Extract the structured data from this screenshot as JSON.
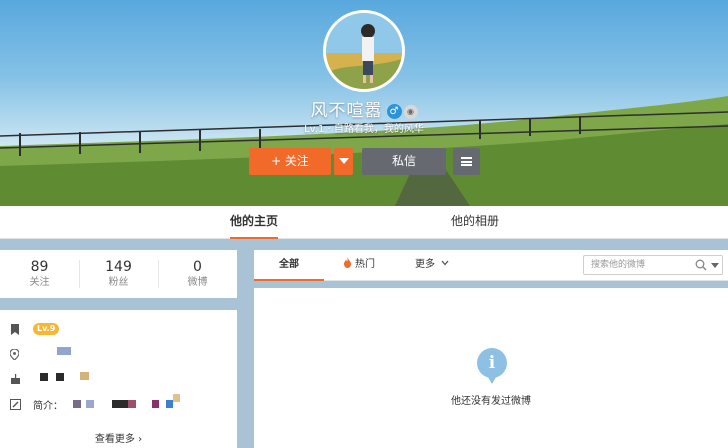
{
  "profile": {
    "name": "风不喧嚣",
    "bio": "Lv.1 · 自路看我，我的风华",
    "gender_icon": "male-icon",
    "badge_icon": "member-badge-icon"
  },
  "actions": {
    "follow_label": "+ 关注",
    "message_label": "私信"
  },
  "tabs": {
    "home": "他的主页",
    "album": "他的相册"
  },
  "stats": [
    {
      "value": "89",
      "label": "关注"
    },
    {
      "value": "149",
      "label": "粉丝"
    },
    {
      "value": "0",
      "label": "微博"
    }
  ],
  "info": {
    "level_badge": "Lv.9",
    "intro_label": "简介：",
    "see_more": "查看更多 ›"
  },
  "feed": {
    "tab_all": "全部",
    "tab_hot": "热门",
    "tab_more": "更多",
    "search_placeholder": "搜索他的微博",
    "empty_text": "他还没有发过微博"
  },
  "colors": {
    "accent": "#f26a2a",
    "button_dark": "#666a70",
    "info_blue": "#8dc0e3",
    "page_bg": "#a9c3d6"
  }
}
